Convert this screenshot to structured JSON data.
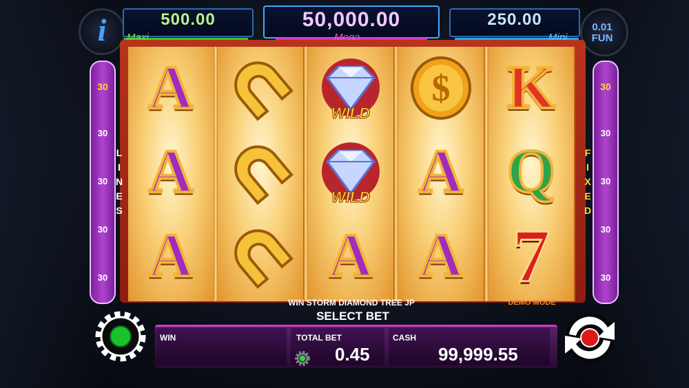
{
  "jackpots": {
    "maxi": {
      "label": "Maxi",
      "value": "500.00"
    },
    "mega": {
      "label": "Mega",
      "value": "50,000.00"
    },
    "mini": {
      "label": "Mini",
      "value": "250.00"
    }
  },
  "info_icon": "info-icon",
  "fun_badge": {
    "value": "0.01",
    "currency": "FUN"
  },
  "reels": [
    [
      "A",
      "A",
      "A"
    ],
    [
      "horseshoe",
      "horseshoe",
      "horseshoe"
    ],
    [
      "diamond-wild",
      "diamond-wild",
      "A"
    ],
    [
      "dollar-coin",
      "A",
      "A"
    ],
    [
      "K",
      "Q",
      "7"
    ]
  ],
  "wild_text": "WILD",
  "lines": {
    "left_label": "LINES",
    "right_label": "FIXED",
    "left_numbers": [
      "30",
      "30",
      "30",
      "30",
      "30"
    ],
    "right_numbers": [
      "30",
      "30",
      "30",
      "30",
      "30"
    ]
  },
  "messages": {
    "game_name": "WIN STORM DIAMOND TREE JP",
    "demo": "DEMO MODE",
    "select_bet": "SELECT BET"
  },
  "bottom": {
    "win_label": "WIN",
    "win_value": "",
    "total_bet_label": "TOTAL BET",
    "total_bet_value": "0.45",
    "cash_label": "CASH",
    "cash_value": "99,999.55"
  },
  "colors": {
    "accent_purple": "#b143cf",
    "reel_gold": "#f9d077",
    "frame_red": "#b7341b",
    "settings_green": "#17c22a",
    "spin_red": "#e01818"
  }
}
